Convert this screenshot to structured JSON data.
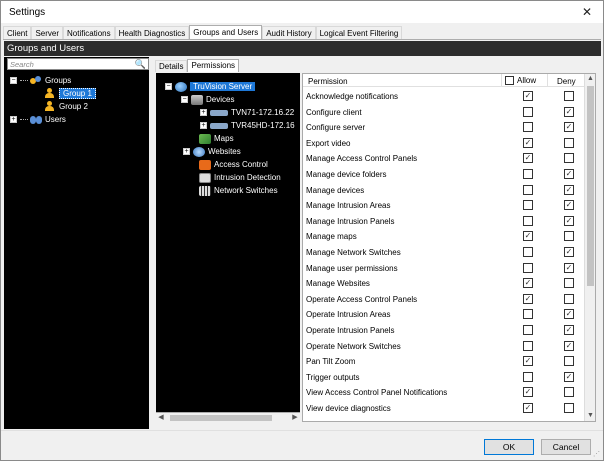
{
  "window": {
    "title": "Settings",
    "close_glyph": "✕"
  },
  "tabs": [
    {
      "label": "Client"
    },
    {
      "label": "Server"
    },
    {
      "label": "Notifications"
    },
    {
      "label": "Health Diagnostics"
    },
    {
      "label": "Groups and Users",
      "active": true
    },
    {
      "label": "Audit History"
    },
    {
      "label": "Logical Event Filtering"
    }
  ],
  "section_title": "Groups and Users",
  "search": {
    "placeholder": "Search"
  },
  "tree": {
    "groups_label": "Groups",
    "group1_label": "Group 1",
    "group2_label": "Group 2",
    "users_label": "Users"
  },
  "detail_tabs": [
    {
      "label": "Details"
    },
    {
      "label": "Permissions",
      "active": true
    }
  ],
  "resources": {
    "server": "TruVision Server",
    "devices": "Devices",
    "device1": "TVN71-172.16.22",
    "device2": "TVR45HD-172.16",
    "maps": "Maps",
    "websites": "Websites",
    "access_control": "Access Control",
    "intrusion_detection": "Intrusion Detection",
    "network_switches": "Network Switches"
  },
  "permissions_table": {
    "col_permission": "Permission",
    "col_allow": "Allow",
    "col_deny": "Deny",
    "rows": [
      {
        "name": "Acknowledge notifications",
        "allow": true,
        "deny": false
      },
      {
        "name": "Configure client",
        "allow": false,
        "deny": true
      },
      {
        "name": "Configure server",
        "allow": false,
        "deny": true
      },
      {
        "name": "Export video",
        "allow": true,
        "deny": false
      },
      {
        "name": "Manage Access Control Panels",
        "allow": true,
        "deny": false
      },
      {
        "name": "Manage device folders",
        "allow": false,
        "deny": true
      },
      {
        "name": "Manage devices",
        "allow": false,
        "deny": true
      },
      {
        "name": "Manage Intrusion Areas",
        "allow": false,
        "deny": true
      },
      {
        "name": "Manage Intrusion Panels",
        "allow": false,
        "deny": true
      },
      {
        "name": "Manage maps",
        "allow": true,
        "deny": false
      },
      {
        "name": "Manage Network Switches",
        "allow": false,
        "deny": true
      },
      {
        "name": "Manage user permissions",
        "allow": false,
        "deny": true
      },
      {
        "name": "Manage Websites",
        "allow": true,
        "deny": false
      },
      {
        "name": "Operate Access Control Panels",
        "allow": true,
        "deny": false
      },
      {
        "name": "Operate Intrusion Areas",
        "allow": false,
        "deny": true
      },
      {
        "name": "Operate Intrusion Panels",
        "allow": false,
        "deny": true
      },
      {
        "name": "Operate Network Switches",
        "allow": false,
        "deny": true
      },
      {
        "name": "Pan Tilt Zoom",
        "allow": true,
        "deny": false
      },
      {
        "name": "Trigger outputs",
        "allow": false,
        "deny": true
      },
      {
        "name": "View Access Control Panel Notifications",
        "allow": true,
        "deny": false
      },
      {
        "name": "View device diagnostics",
        "allow": true,
        "deny": false
      }
    ]
  },
  "buttons": {
    "ok": "OK",
    "cancel": "Cancel"
  },
  "colors": {
    "selection": "#1e78d7",
    "header_bg": "#2c2c2c"
  }
}
